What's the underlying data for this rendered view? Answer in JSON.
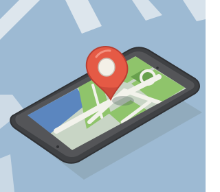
{
  "illustration": {
    "subject": "smartphone-with-map-location-pin",
    "icons": [
      "map-pin-icon"
    ]
  },
  "colors": {
    "background": "#9dbad3",
    "watermark_stripe": "#e9eef2",
    "phone_body": "#4d4f52",
    "phone_body_edge": "#2f3134",
    "screen_map_base": "#c8d5c5",
    "map_green": "#8fc46b",
    "map_dark_green": "#68a04d",
    "map_water": "#5b86bf",
    "map_road": "#f2f2eb",
    "pin_red": "#e55a45",
    "pin_dark_red": "#b83f33",
    "pin_center": "#f3f0e7",
    "shadow": "#7b8f95"
  }
}
